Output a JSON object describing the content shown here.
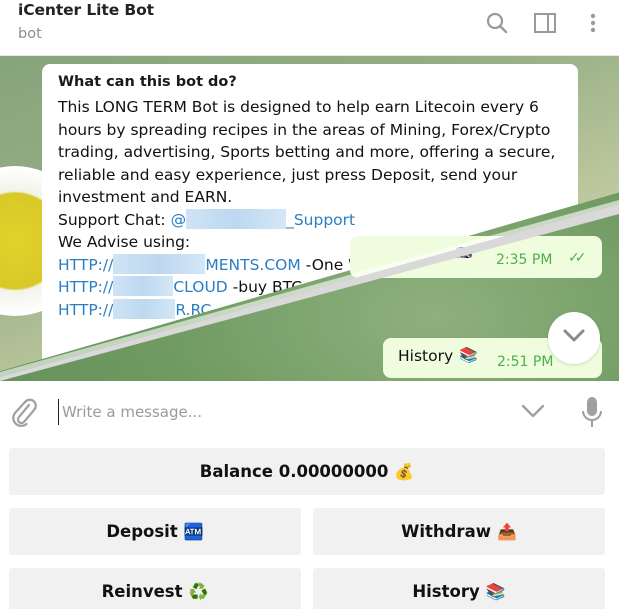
{
  "header": {
    "title": "iCenter Lite Bot",
    "subtitle": "bot",
    "icons": [
      "search-icon",
      "sidebar-toggle-icon",
      "more-vertical-icon"
    ]
  },
  "chat": {
    "bot_info": {
      "heading": "What can this bot do?",
      "description": "This LONG TERM Bot is designed to help earn Litecoin every 6 hours by spreading recipes in the areas of Mining, Forex/Crypto trading, advertising, Sports betting and more, offering a secure, reliable and easy experience, just press Deposit, send your investment and EARN.",
      "support_label": "Support Chat: ",
      "support_link_prefix": "@",
      "support_link_suffix": "_Support",
      "advise_label": "We Advise using:",
      "links": [
        {
          "prefix": "HTTP://",
          "suffix": "MENTS.COM",
          "note": " -One Wallet f..."
        },
        {
          "prefix": "HTTP://",
          "suffix": "CLOUD",
          "note": " -buy BTC"
        },
        {
          "prefix": "HTTP://",
          "suffix": "R.RC",
          "note": ""
        }
      ],
      "time": "2:35 PM"
    },
    "outgoing": [
      {
        "text": "",
        "emoji": "🇬🇧",
        "time": "2:35 PM",
        "status": "read"
      },
      {
        "text": "History",
        "emoji": "📚",
        "time": "2:51 PM",
        "status": "read"
      }
    ],
    "scroll_down_icon": "chevron-down-icon"
  },
  "composer": {
    "placeholder": "Write a message...",
    "value": ""
  },
  "keyboard": {
    "rows": [
      [
        {
          "label": "Balance 0.00000000",
          "emoji": "💰"
        }
      ],
      [
        {
          "label": "Deposit",
          "emoji": "🏧"
        },
        {
          "label": "Withdraw",
          "emoji": "📤"
        }
      ],
      [
        {
          "label": "Reinvest",
          "emoji": "♻️"
        },
        {
          "label": "History",
          "emoji": "📚"
        }
      ]
    ]
  },
  "colors": {
    "accent_link": "#2a7fc4",
    "outgoing_bubble": "#effdde",
    "outgoing_time": "#4eb04a",
    "keyboard_button": "#f1f1f1"
  }
}
